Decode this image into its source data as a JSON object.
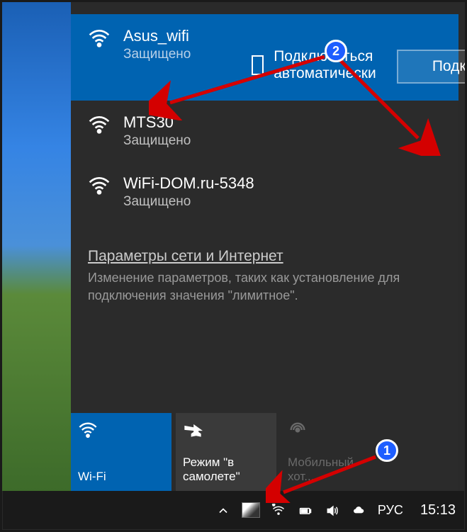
{
  "wifi_networks": [
    {
      "name": "Asus_wifi",
      "status": "Защищено",
      "selected": true
    },
    {
      "name": "MTS30",
      "status": "Защищено",
      "selected": false
    },
    {
      "name": "WiFi-DOM.ru-5348",
      "status": "Защищено",
      "selected": false
    }
  ],
  "auto_connect_label": "Подключаться автоматически",
  "connect_button": "Подключиться",
  "settings": {
    "link": "Параметры сети и Интернет",
    "description": "Изменение параметров, таких как установление для подключения значения \"лимитное\"."
  },
  "tiles": {
    "wifi": "Wi-Fi",
    "airplane": "Режим \"в самолете\"",
    "hotspot": "Мобильный хот..."
  },
  "taskbar": {
    "lang": "РУС",
    "time": "15:13"
  },
  "callouts": {
    "one": "1",
    "two": "2"
  }
}
